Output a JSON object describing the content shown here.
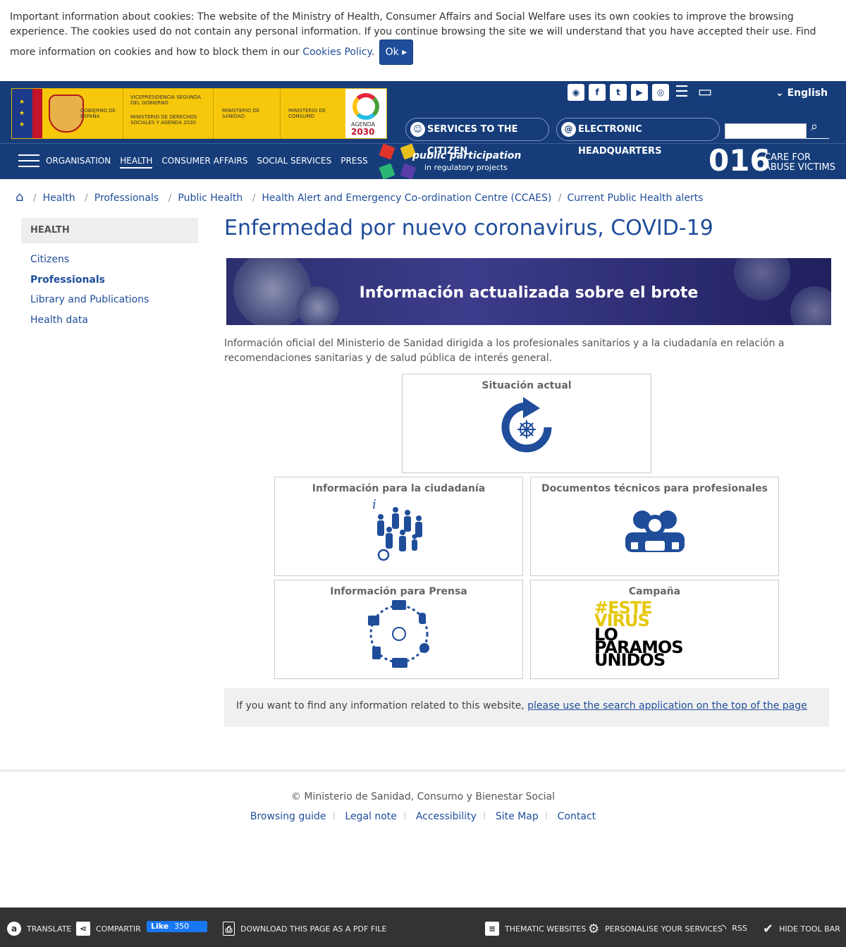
{
  "cookie": {
    "text": "Important information about cookies: The website of the Ministry of Health, Consumer Affairs and Social Welfare uses its own cookies to improve the browsing experience. The cookies used do not contain any personal information. If you continue browsing the site we will understand that you have accepted their use. Find more information on cookies and how to block them in our",
    "link": "Cookies Policy",
    "ok": "Ok"
  },
  "logo": {
    "gobierno": "GOBIERNO DE ESPAÑA",
    "vicepresidencia": "VICEPRESIDENCIA SEGUNDA DEL GOBIERNO",
    "derechos": "MINISTERIO DE DERECHOS SOCIALES Y AGENDA 2030",
    "sanidad": "MINISTERIO DE SANIDAD",
    "consumo": "MINISTERIO DE CONSUMO",
    "agenda": "AGENDA",
    "agenda_year": "2030"
  },
  "header": {
    "language": "English",
    "services_citizen": "SERVICES TO THE CITIZEN",
    "electronic_hq": "ELECTRONIC HEADQUARTERS",
    "social_icons": [
      "rss-icon",
      "facebook-icon",
      "twitter-icon",
      "youtube-icon",
      "instagram-icon",
      "list-icon",
      "laptop-icon"
    ],
    "nav": [
      "ORGANISATION",
      "HEALTH",
      "CONSUMER AFFAIRS",
      "SOCIAL SERVICES",
      "PRESS"
    ],
    "nav_active": "HEALTH",
    "participation_title": "public participation",
    "participation_sub": "in regulatory projects",
    "hotline_number": "016",
    "hotline_text_1": "CARE FOR",
    "hotline_text_2": "ABUSE VICTIMS",
    "brand_color": "#163d7a"
  },
  "breadcrumb": [
    "Health",
    "Professionals",
    "Public Health",
    "Health Alert and Emergency Co-ordination Centre (CCAES)",
    "Current Public Health alerts"
  ],
  "sidebar": {
    "heading": "HEALTH",
    "items": [
      "Citizens",
      "Professionals",
      "Library and Publications",
      "Health data"
    ],
    "current": "Professionals"
  },
  "main": {
    "title": "Enfermedad por nuevo coronavirus, COVID-19",
    "banner_text": "Información actualizada sobre el brote",
    "intro": "Información oficial del Ministerio de Sanidad dirigida a los profesionales sanitarios y a la ciudadanía en relación a recomendaciones sanitarias y de salud pública de interés general.",
    "cards": {
      "situacion": "Situación actual",
      "ciudadania": "Información para la ciudadanía",
      "documentos": "Documentos técnicos para profesionales",
      "prensa": "Información para Prensa",
      "campana": "Campaña"
    },
    "campaign_lines": [
      "#ESTE",
      "VIRUS",
      "LO",
      "PARAMOS",
      "UNIDOS"
    ],
    "search_hint": "If you want to find any information related to this website,",
    "search_link": "please use the search application on the top of the page"
  },
  "footer": {
    "copyright": "© Ministerio de Sanidad, Consumo y Bienestar Social",
    "links": [
      "Browsing guide",
      "Legal note",
      "Accessibility",
      "Site Map",
      "Contact"
    ]
  },
  "toolbar": {
    "translate": "TRANSLATE",
    "share": "COMPARTIR",
    "fb_like": "Like",
    "fb_count": "350",
    "pdf": "DOWNLOAD THIS PAGE AS A PDF FILE",
    "thematic": "THEMATIC WEBSITES",
    "personalise": "PERSONALISE YOUR SERVICES",
    "rss": "RSS",
    "hide": "HIDE TOOL BAR"
  }
}
